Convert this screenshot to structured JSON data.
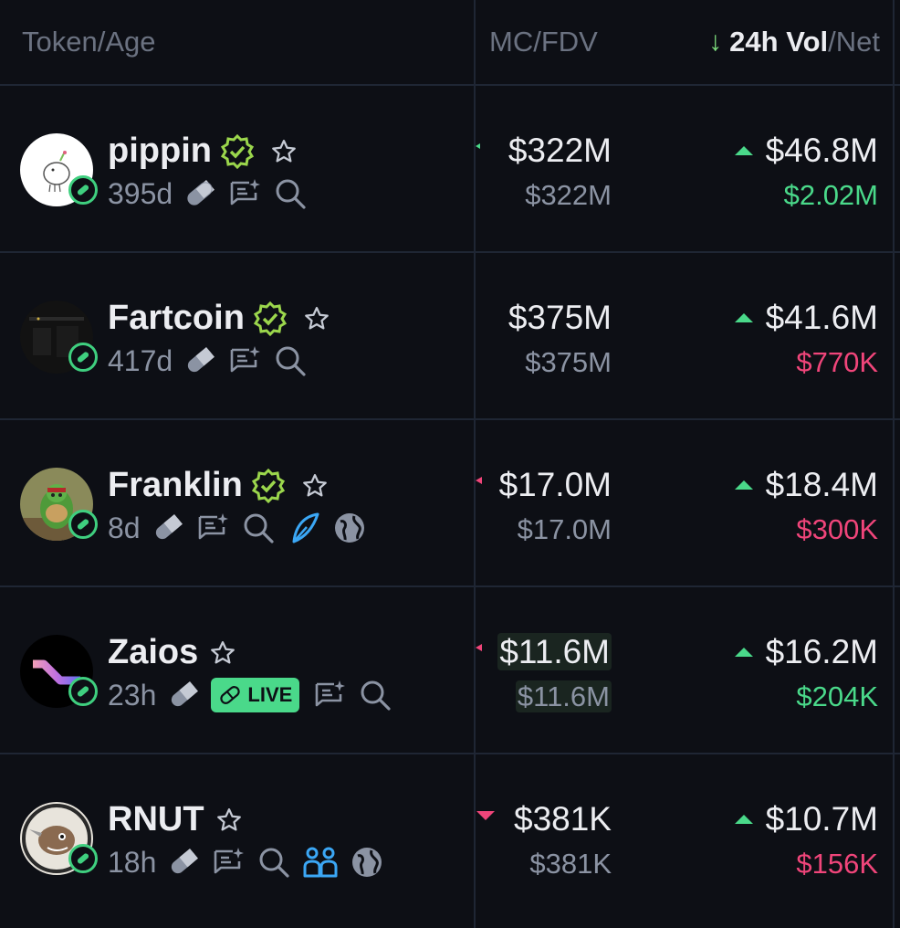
{
  "header": {
    "token_age": "Token/Age",
    "mc_fdv": "MC/FDV",
    "vol_label": "24h Vol",
    "net_label": "/Net"
  },
  "colors": {
    "positive": "#4ad98a",
    "negative": "#f0457a",
    "accent_blue": "#3ba7f5"
  },
  "rows": [
    {
      "name": "pippin",
      "age": "395d",
      "verified": true,
      "mc": "$322M",
      "fdv": "$322M",
      "vol": "$46.8M",
      "net": "$2.02M",
      "net_sign": "positive",
      "icons": [
        "pill-icon",
        "chat-sparkle-icon",
        "search-icon"
      ]
    },
    {
      "name": "Fartcoin",
      "age": "417d",
      "verified": true,
      "mc": "$375M",
      "fdv": "$375M",
      "vol": "$41.6M",
      "net": "$770K",
      "net_sign": "negative",
      "icons": [
        "pill-icon",
        "chat-sparkle-icon",
        "search-icon"
      ]
    },
    {
      "name": "Franklin",
      "age": "8d",
      "verified": true,
      "mc": "$17.0M",
      "fdv": "$17.0M",
      "vol": "$18.4M",
      "net": "$300K",
      "net_sign": "negative",
      "icons": [
        "pill-icon",
        "chat-sparkle-icon",
        "search-icon",
        "feather-icon",
        "globe-icon"
      ]
    },
    {
      "name": "Zaios",
      "age": "23h",
      "verified": false,
      "live_label": "LIVE",
      "mc": "$11.6M",
      "fdv": "$11.6M",
      "vol": "$16.2M",
      "net": "$204K",
      "net_sign": "positive",
      "icons": [
        "pill-icon",
        "live-badge",
        "chat-sparkle-icon",
        "search-icon"
      ]
    },
    {
      "name": "RNUT",
      "age": "18h",
      "verified": false,
      "mc": "$381K",
      "fdv": "$381K",
      "vol": "$10.7M",
      "net": "$156K",
      "net_sign": "negative",
      "icons": [
        "pill-icon",
        "chat-sparkle-icon",
        "search-icon",
        "community-icon",
        "globe-icon"
      ]
    }
  ]
}
